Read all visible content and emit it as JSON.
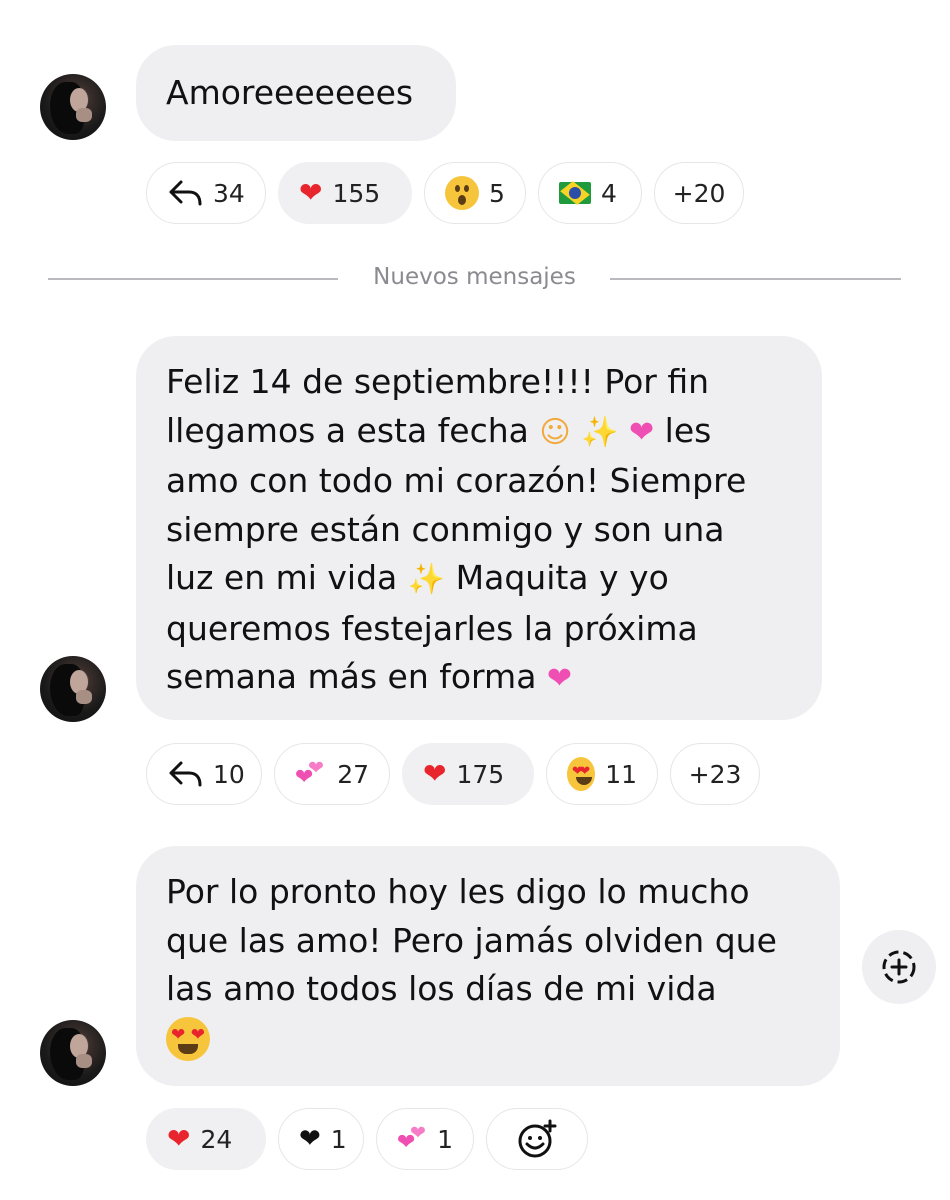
{
  "messages": [
    {
      "text": "Amoreeeeeees",
      "reactions": [
        {
          "icon": "reply-arrow-icon",
          "count": "34"
        },
        {
          "icon": "red-heart-icon",
          "count": "155",
          "active": true
        },
        {
          "icon": "surprised-face-icon",
          "count": "5"
        },
        {
          "icon": "brazil-flag-icon",
          "count": "4"
        },
        {
          "label": "+20"
        }
      ]
    },
    {
      "text_lines": [
        "Feliz 14 de septiembre!!!! Por fin",
        "llegamos a esta fecha",
        "les",
        "amo con todo mi corazón! Siempre",
        "siempre están conmigo y son una",
        "luz en mi vida",
        "Maquita y yo",
        "queremos festejarles la próxima",
        "semana más en forma"
      ],
      "reactions": [
        {
          "icon": "reply-arrow-icon",
          "count": "10"
        },
        {
          "icon": "two-hearts-icon",
          "count": "27"
        },
        {
          "icon": "red-heart-icon",
          "count": "175",
          "active": true
        },
        {
          "icon": "heart-eyes-face-icon",
          "count": "11"
        },
        {
          "label": "+23"
        }
      ]
    },
    {
      "text_lines": [
        "Por lo pronto hoy les digo lo mucho",
        "que las amo! Pero jamás olviden que",
        "las amo todos los días de mi vida"
      ],
      "reactions": [
        {
          "icon": "red-heart-icon",
          "count": "24",
          "active": true
        },
        {
          "icon": "black-heart-icon",
          "count": "1"
        },
        {
          "icon": "two-hearts-icon",
          "count": "1"
        },
        {
          "icon": "add-reaction-icon"
        }
      ]
    }
  ],
  "divider_label": "Nuevos mensajes",
  "colors": {
    "bubble": "#efeff2",
    "chip_border": "#e6e6ea",
    "heart": "#e8252c",
    "divider": "#b9b9be",
    "divider_text": "#8a8a90"
  }
}
